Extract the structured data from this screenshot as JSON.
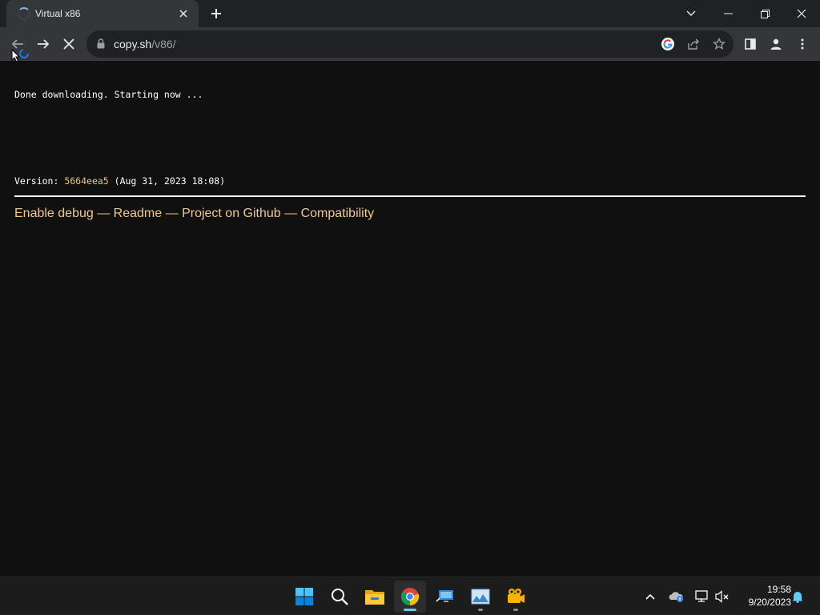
{
  "window": {
    "tab_title": "Virtual x86",
    "controls": [
      "chevron-down-icon",
      "minimize-icon",
      "restore-icon",
      "close-icon"
    ]
  },
  "toolbar": {
    "url_host": "copy.sh",
    "url_path": "/v86/",
    "icons": [
      "back-icon",
      "forward-icon",
      "stop-icon",
      "lock-icon",
      "google-icon",
      "share-icon",
      "star-icon",
      "side-panel-icon",
      "profile-icon",
      "menu-icon"
    ]
  },
  "page": {
    "status": "Done downloading. Starting now ...",
    "version_label": "Version:",
    "version_hash": "5664eea5",
    "version_date": "(Aug 31, 2023 18:08)",
    "links": [
      "Enable debug",
      "Readme",
      "Project on Github",
      "Compatibility"
    ],
    "separator": "—"
  },
  "taskbar": {
    "apps": [
      "windows-start-icon",
      "search-icon",
      "file-explorer-icon",
      "chrome-icon",
      "remote-desktop-icon",
      "photos-icon",
      "media-app-icon"
    ],
    "active_app": "chrome-icon",
    "tray_icons": [
      "show-hidden-icons-chevron",
      "onedrive-icon",
      "network-icon",
      "volume-muted-icon",
      "notification-bell-icon"
    ],
    "time": "19:58",
    "date": "9/20/2023"
  },
  "colors": {
    "page_bg": "#101010",
    "link": "#f0c98a",
    "version_hash": "#f0c674",
    "toolbar_bg": "#35363a",
    "tabstrip_bg": "#202124",
    "accent": "#60cdff"
  }
}
